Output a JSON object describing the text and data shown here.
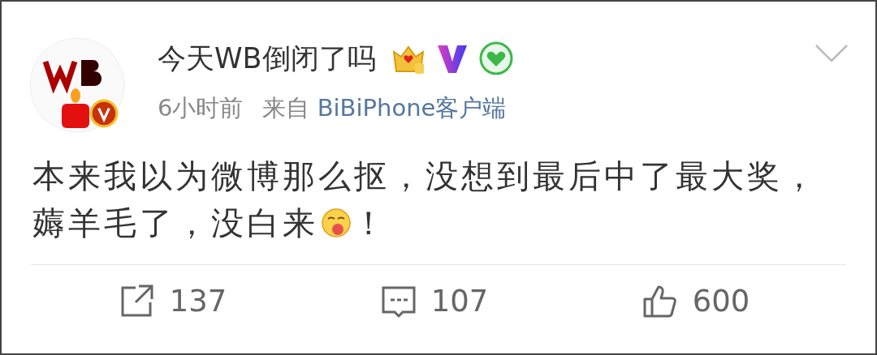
{
  "post": {
    "author": "今天WB倒闭了吗",
    "time": "6小时前",
    "source_prefix": "来自",
    "source": "BiBiPhone客户端",
    "lines": [
      "本来我以为微博那么抠，没想到最后中了最大奖，",
      "薅羊毛了，没白来"
    ],
    "text_end": "！",
    "verified": true
  },
  "actions": [
    {
      "kind": "repost",
      "count": "137"
    },
    {
      "kind": "comment",
      "count": "107"
    },
    {
      "kind": "like",
      "count": "600"
    }
  ]
}
